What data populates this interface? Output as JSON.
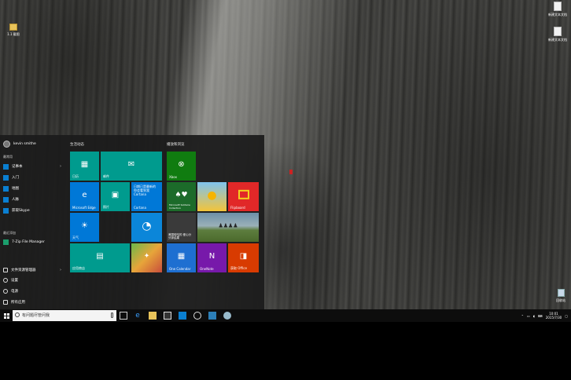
{
  "desktop": {
    "icons_right": [
      {
        "label": "新建文本文档",
        "icon": "document-icon"
      },
      {
        "label": "新建文本文档",
        "icon": "document-icon"
      }
    ],
    "icon_left": {
      "label": "1.1 截图",
      "icon": "folder-icon"
    },
    "recycle_bin": {
      "label": "回收站",
      "icon": "recycle-bin-icon"
    }
  },
  "start_menu": {
    "user": "kevin smithe",
    "most_used_label": "最常用",
    "most_used": [
      {
        "label": "记事本",
        "icon": "notepad-icon",
        "has_arrow": true
      },
      {
        "label": "入门",
        "icon": "tips-icon",
        "has_arrow": false
      },
      {
        "label": "地图",
        "icon": "maps-icon",
        "has_arrow": false
      },
      {
        "label": "人脉",
        "icon": "people-icon",
        "has_arrow": false
      },
      {
        "label": "获取Skype",
        "icon": "skype-icon",
        "has_arrow": false
      }
    ],
    "recent_label": "最近添加",
    "recent": [
      {
        "label": "7-Zip File Manager",
        "icon": "7zip-icon"
      }
    ],
    "bottom": [
      {
        "label": "文件资源管理器",
        "icon": "file-explorer-icon",
        "has_arrow": true
      },
      {
        "label": "设置",
        "icon": "gear-icon"
      },
      {
        "label": "电源",
        "icon": "power-icon"
      },
      {
        "label": "所有应用",
        "icon": "all-apps-icon"
      }
    ],
    "groups": [
      {
        "label": "生活动态"
      },
      {
        "label": "播放和浏览"
      }
    ],
    "tiles": {
      "calendar": {
        "label": "日历"
      },
      "mail": {
        "label": "邮件"
      },
      "edge": {
        "label": "Microsoft Edge"
      },
      "photos": {
        "label": "照片"
      },
      "cortana": {
        "label": "Cortana",
        "text": "日期已是最新的 你会看到我 Cortana"
      },
      "weather": {
        "label": "天气"
      },
      "qq": {
        "label": ""
      },
      "store": {
        "label": "应用商店"
      },
      "xbox": {
        "label": "Xbox"
      },
      "solitaire": {
        "label": "Microsoft Solitaire Collection"
      },
      "puzzle": {
        "label": ""
      },
      "flipboard": {
        "label": "Flipboard"
      },
      "news": {
        "label": "美国哈哈的 爱心分 分钟结果"
      },
      "photo_tile": {
        "label": ""
      },
      "onecalendar": {
        "label": "One Calendar"
      },
      "onenote": {
        "label": "OneNote"
      },
      "office": {
        "label": "获取 Office"
      }
    }
  },
  "taskbar": {
    "search_placeholder": "有问题尽管问我",
    "time": "10:01",
    "date": "2015/7/30",
    "pinned": [
      {
        "icon": "task-view-icon"
      },
      {
        "icon": "edge-icon"
      },
      {
        "icon": "file-explorer-icon"
      },
      {
        "icon": "store-icon"
      },
      {
        "icon": "mail-icon"
      },
      {
        "icon": "media-player-icon"
      },
      {
        "icon": "photos-icon"
      },
      {
        "icon": "paint-icon"
      }
    ]
  },
  "colors": {
    "tile_teal": "#009b8e",
    "tile_blue": "#0078d7",
    "tile_green": "#107c10",
    "tile_onecal": "#1e6fd1",
    "tile_onenote": "#7719aa",
    "tile_office": "#d83b01",
    "tile_flip": "#e12828"
  }
}
